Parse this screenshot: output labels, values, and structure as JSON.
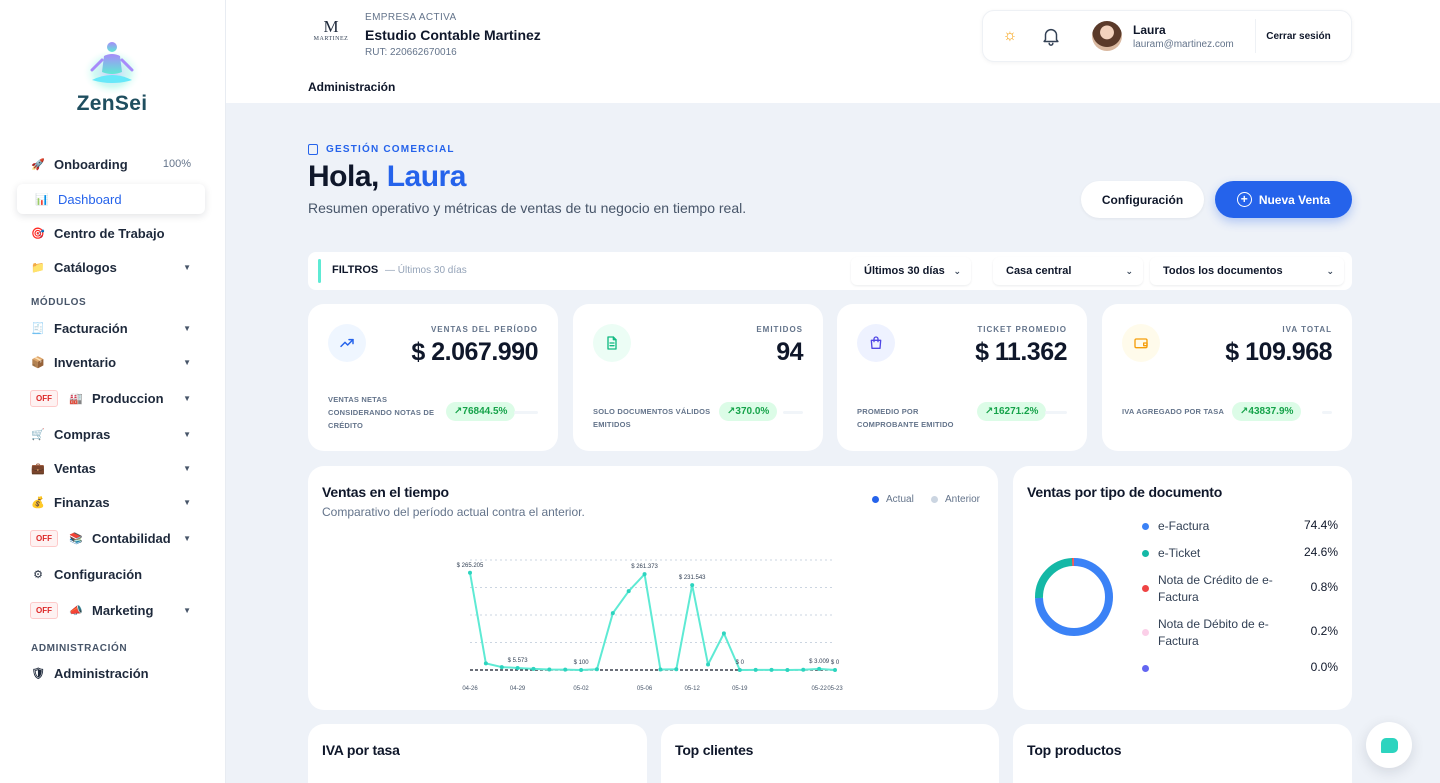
{
  "brand": {
    "name": "ZenSei"
  },
  "sidebar": {
    "items": [
      {
        "label": "Onboarding",
        "extra": "100%"
      },
      {
        "label": "Dashboard"
      },
      {
        "label": "Centro de Trabajo"
      },
      {
        "label": "Catálogos"
      }
    ],
    "modules_label": "MÓDULOS",
    "modules": [
      {
        "label": "Facturación"
      },
      {
        "label": "Inventario"
      },
      {
        "label": "Produccion",
        "badge": "OFF"
      },
      {
        "label": "Compras"
      },
      {
        "label": "Ventas"
      },
      {
        "label": "Finanzas"
      },
      {
        "label": "Contabilidad",
        "badge": "OFF"
      },
      {
        "label": "Configuración"
      },
      {
        "label": "Marketing",
        "badge": "OFF"
      }
    ],
    "admin_label": "ADMINISTRACIÓN",
    "admin_item": {
      "label": "Administración"
    }
  },
  "header": {
    "company_logo_letter": "M",
    "company_logo_name": "MARTINEZ",
    "company_label": "EMPRESA ACTIVA",
    "company_name": "Estudio Contable Martinez",
    "company_rut": "RUT: 220662670016",
    "tab": "Administración",
    "user_name": "Laura",
    "user_email": "lauram@martinez.com",
    "logout": "Cerrar sesión"
  },
  "page": {
    "eyebrow": "GESTIÓN COMERCIAL",
    "greeting": "Hola,",
    "greeting_name": "Laura",
    "subtitle": "Resumen operativo y métricas de ventas de tu negocio en tiempo real.",
    "config_button": "Configuración",
    "new_sale_button": "Nueva Venta"
  },
  "filters": {
    "title": "FILTROS",
    "subtitle": "— Últimos 30 días",
    "period": "Últimos 30 días",
    "branch": "Casa central",
    "documents": "Todos los documentos"
  },
  "kpis": [
    {
      "label": "VENTAS DEL PERÍODO",
      "value": "$ 2.067.990",
      "desc": "VENTAS NETAS CONSIDERANDO NOTAS DE CRÉDITO",
      "change": "↗76844.5%",
      "color": "#2563eb",
      "bg": "#eff6ff"
    },
    {
      "label": "EMITIDOS",
      "value": "94",
      "desc": "SOLO DOCUMENTOS VÁLIDOS EMITIDOS",
      "change": "↗370.0%",
      "color": "#10b981",
      "bg": "#ecfdf5"
    },
    {
      "label": "TICKET PROMEDIO",
      "value": "$ 11.362",
      "desc": "PROMEDIO POR COMPROBANTE EMITIDO",
      "change": "↗16271.2%",
      "color": "#4f46e5",
      "bg": "#eef2ff"
    },
    {
      "label": "IVA TOTAL",
      "value": "$ 109.968",
      "desc": "IVA AGREGADO POR TASA",
      "change": "↗43837.9%",
      "color": "#f59e0b",
      "bg": "#fffbeb"
    }
  ],
  "sales_chart": {
    "title": "Ventas en el tiempo",
    "subtitle": "Comparativo del período actual contra el anterior.",
    "legend_actual": "Actual",
    "legend_anterior": "Anterior"
  },
  "chart_data": [
    {
      "type": "line",
      "x_ticks": [
        "04-26",
        "04-29",
        "05-02",
        "05-06",
        "05-12",
        "05-19",
        "05-22",
        "05-23"
      ],
      "series": [
        {
          "name": "Actual",
          "values": [
            265205,
            18000,
            8000,
            5573,
            3000,
            1500,
            1000,
            100,
            2000,
            155000,
            215000,
            261373,
            1500,
            2000,
            231543,
            15000,
            100000,
            0,
            500,
            300,
            0,
            800,
            3009,
            0
          ]
        },
        {
          "name": "Anterior",
          "values": [
            0,
            0,
            0,
            0,
            0,
            0,
            0,
            0,
            0,
            0,
            0,
            0,
            0,
            0,
            0,
            0,
            0,
            0,
            0,
            0,
            0,
            0,
            0,
            0
          ]
        }
      ],
      "data_labels": [
        {
          "index": 0,
          "text": "$ 265.205"
        },
        {
          "index": 3,
          "text": "$ 5.573"
        },
        {
          "index": 7,
          "text": "$ 100"
        },
        {
          "index": 11,
          "text": "$ 261.373"
        },
        {
          "index": 14,
          "text": "$ 231.543"
        },
        {
          "index": 17,
          "text": "$ 0"
        },
        {
          "index": 22,
          "text": "$ 3.009"
        },
        {
          "index": 23,
          "text": "$ 0"
        }
      ],
      "ylim": [
        0,
        300000
      ],
      "grid": true
    },
    {
      "type": "pie",
      "title": "Ventas por tipo de documento",
      "categories": [
        "e-Factura",
        "e-Ticket",
        "Nota de Crédito de e-Factura",
        "Nota de Débito de e-Factura",
        ""
      ],
      "labels": [
        "74.4%",
        "24.6%",
        "0.8%",
        "0.2%",
        "0.0%"
      ],
      "values": [
        74.4,
        24.6,
        0.8,
        0.2,
        0.0
      ],
      "colors": [
        "#3b82f6",
        "#14b8a6",
        "#ef4444",
        "#fbcfe8",
        "#6366f1"
      ]
    }
  ],
  "bottom_cards": [
    "IVA por tasa",
    "Top clientes",
    "Top productos"
  ]
}
